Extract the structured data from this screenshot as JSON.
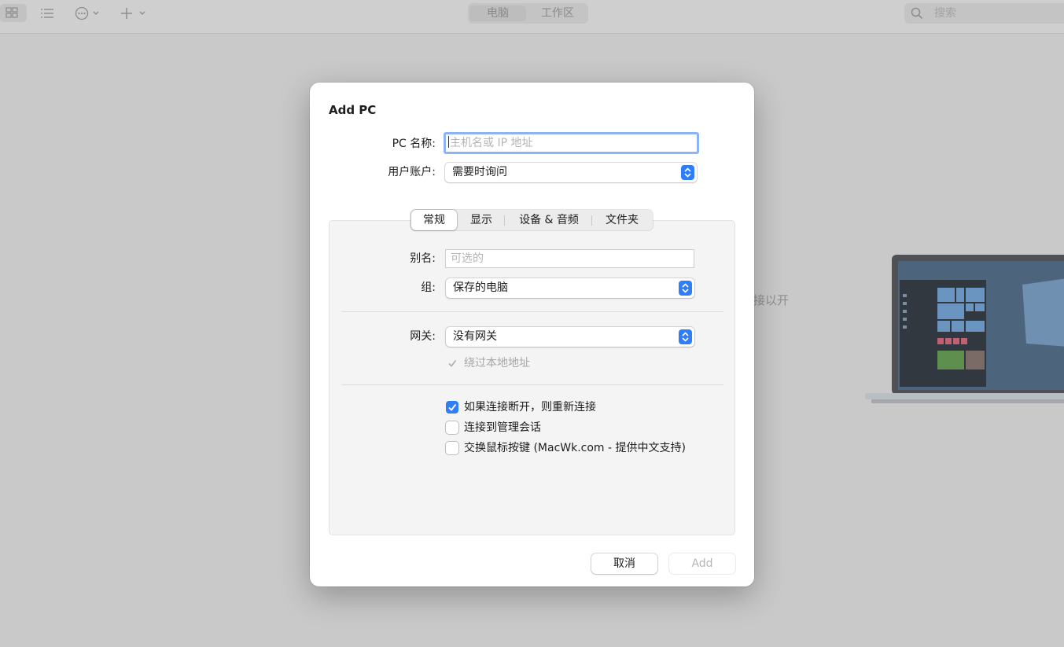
{
  "toolbar": {
    "segments": [
      "电脑",
      "工作区"
    ],
    "search_placeholder": "搜索"
  },
  "background": {
    "partial_text": "接以开"
  },
  "dialog": {
    "title": "Add PC",
    "pc_name_label": "PC 名称:",
    "pc_name_placeholder": "主机名或 IP 地址",
    "user_account_label": "用户账户:",
    "user_account_value": "需要时询问",
    "tabs": [
      "常规",
      "显示",
      "设备 & 音频",
      "文件夹"
    ],
    "active_tab": "常规",
    "general": {
      "alias_label": "别名:",
      "alias_placeholder": "可选的",
      "group_label": "组:",
      "group_value": "保存的电脑",
      "gateway_label": "网关:",
      "gateway_value": "没有网关",
      "bypass_label": "绕过本地地址",
      "bypass_checked": true,
      "reconnect_label": "如果连接断开，则重新连接",
      "reconnect_checked": true,
      "admin_label": "连接到管理会话",
      "admin_checked": false,
      "swap_label": "交换鼠标按键 (MacWk.com - 提供中文支持)",
      "swap_checked": false
    },
    "cancel_label": "取消",
    "add_label": "Add"
  },
  "colors": {
    "accent": "#2f7ef6",
    "focus_ring": "#8cb4f2"
  }
}
